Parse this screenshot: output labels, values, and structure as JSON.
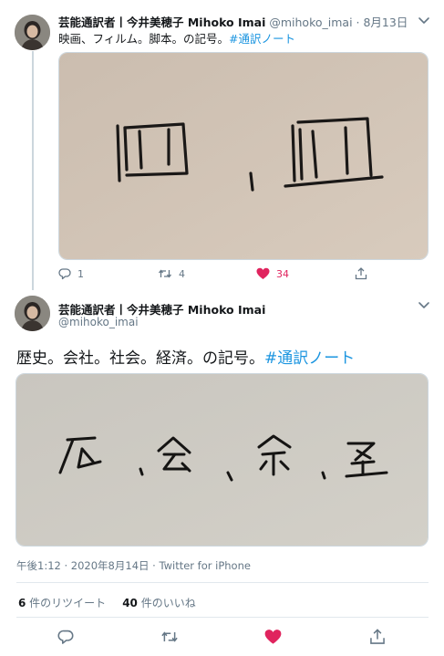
{
  "tweet1": {
    "display_name": "芸能通訳者丨今井美穂子 Mihoko Imai",
    "handle": "@mihoko_imai",
    "dot": " · ",
    "date": "8月13日",
    "text": "映画、フィルム。脚本。の記号。",
    "hashtag": "#通訳ノート",
    "reply_count": "1",
    "retweet_count": "4",
    "like_count": "34",
    "liked": true,
    "icons": [
      "avatar",
      "chevron-down-icon",
      "reply-icon",
      "retweet-icon",
      "heart-icon",
      "share-icon"
    ]
  },
  "tweet2": {
    "display_name": "芸能通訳者丨今井美穂子 Mihoko Imai",
    "handle": "@mihoko_imai",
    "text": "歴史。会社。社会。経済。の記号。",
    "hashtag": "#通訳ノート",
    "timestamp": "午後1:12 · 2020年8月14日 · Twitter for iPhone",
    "retweets_number": "6",
    "retweets_label": " 件のリツイート",
    "likes_number": "40",
    "likes_label": " 件のいいね",
    "liked": true,
    "icons": [
      "avatar",
      "chevron-down-icon",
      "reply-icon",
      "retweet-icon",
      "heart-icon",
      "share-icon"
    ]
  },
  "colors": {
    "link": "#1b95e0",
    "muted": "#657786",
    "like": "#e0245e",
    "divider": "#e1e8ed"
  }
}
